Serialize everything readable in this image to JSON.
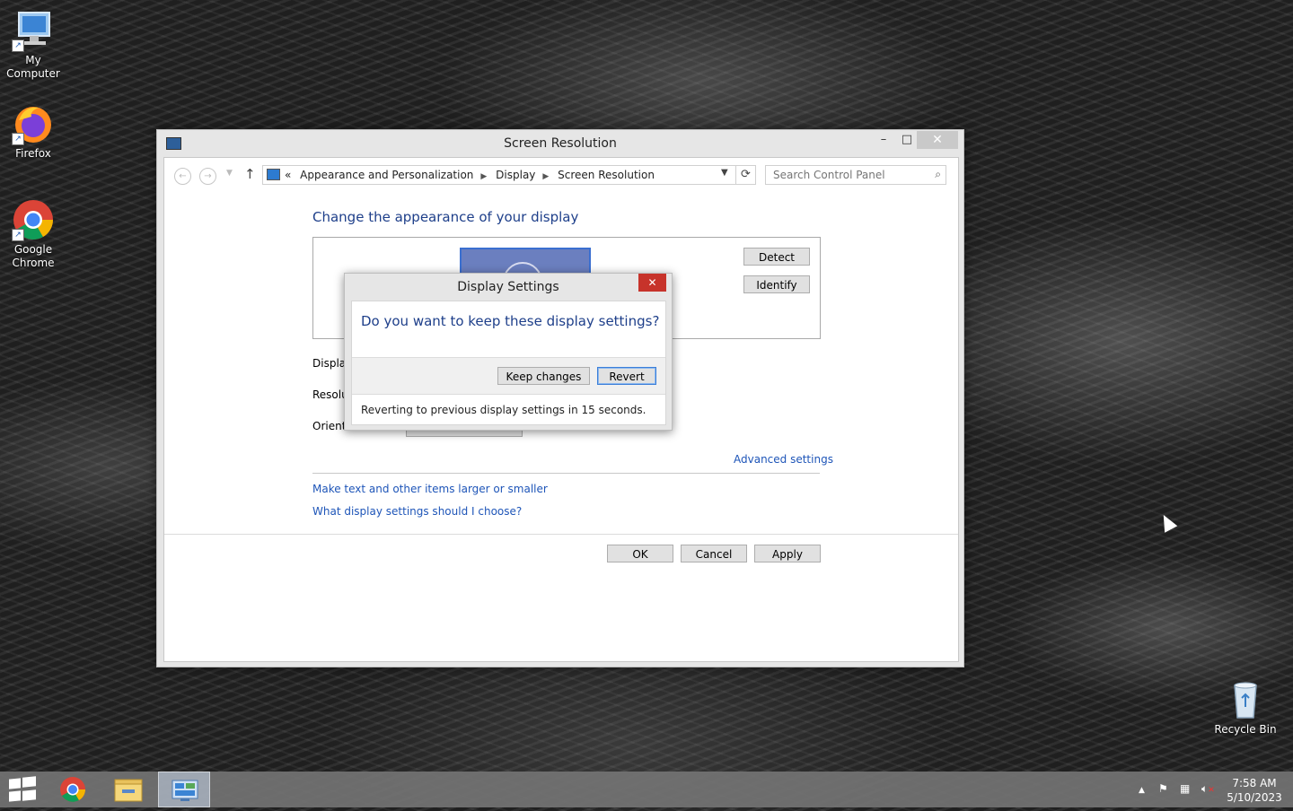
{
  "desktop": {
    "icons": [
      {
        "label": "My Computer",
        "icon": "computer-icon"
      },
      {
        "label": "Firefox",
        "icon": "firefox-icon"
      },
      {
        "label": "Google Chrome",
        "icon": "chrome-icon"
      },
      {
        "label": "Recycle Bin",
        "icon": "recycle-bin-icon"
      }
    ]
  },
  "window": {
    "title": "Screen Resolution",
    "address": {
      "prefix": "«",
      "crumbs": [
        "Appearance and Personalization",
        "Display",
        "Screen Resolution"
      ]
    },
    "search_placeholder": "Search Control Panel",
    "heading": "Change the appearance of your display",
    "detect_label": "Detect",
    "identify_label": "Identify",
    "display_label": "Display",
    "resolution_label": "Resolu",
    "orientation_label": "Orienta",
    "advanced_link": "Advanced settings",
    "link_text_size": "Make text and other items larger or smaller",
    "link_help": "What display settings should I choose?",
    "ok_label": "OK",
    "cancel_label": "Cancel",
    "apply_label": "Apply"
  },
  "dialog": {
    "title": "Display Settings",
    "question": "Do you want to keep these display settings?",
    "keep_label": "Keep changes",
    "revert_label": "Revert",
    "status": "Reverting to previous display settings in 15 seconds."
  },
  "taskbar": {
    "time": "7:58 AM",
    "date": "5/10/2023"
  },
  "colors": {
    "heading_blue": "#1e3f8a",
    "link_blue": "#1e55b8",
    "close_red": "#c7332b"
  }
}
